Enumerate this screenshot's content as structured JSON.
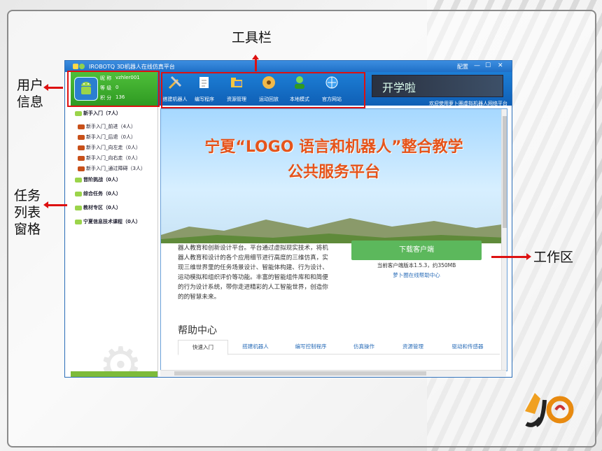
{
  "annotations": {
    "toolbar": "工具栏",
    "user_info": [
      "用户",
      "信息"
    ],
    "task_list": [
      "任务",
      "列表",
      "窗格"
    ],
    "work_area": "工作区"
  },
  "window": {
    "title": "IROBOTQ 3D机器人在线仿真平台",
    "config_label": "配置",
    "min_glyph": "—",
    "max_glyph": "☐",
    "close_glyph": "✕"
  },
  "user": {
    "nickname_label": "昵 称",
    "nickname": "vzhler001",
    "level_label": "等 级",
    "level": "0",
    "points_label": "积 分",
    "points": "136"
  },
  "toolbar": {
    "buttons": [
      {
        "label": "搭建机器人",
        "icon": "wrench-icon"
      },
      {
        "label": "编写程序",
        "icon": "notepad-icon"
      },
      {
        "label": "资源管理",
        "icon": "folder-icon"
      },
      {
        "label": "运动回放",
        "icon": "film-icon"
      },
      {
        "label": "本地模式",
        "icon": "user-icon"
      },
      {
        "label": "官方网站",
        "icon": "globe-icon"
      }
    ],
    "banner_text": "开学啦",
    "welcome": "欢迎使用萝卜圈虚拟机器人网络平台"
  },
  "sidebar": {
    "cat1": "新手入门（7人）",
    "sub1": "新手入门_前进（4人）",
    "sub2": "新手入门_后退（0人）",
    "sub3": "新手入门_向左走（0人）",
    "sub4": "新手入门_向右走（0人）",
    "sub5": "新手入门_通过障碍（3人）",
    "cat2": "晋阶挑战（0人）",
    "cat3": "综合任务（0人）",
    "cat4": "教材专区（0人）",
    "cat5": "宁夏信息技术课程（0人）"
  },
  "work": {
    "hero_line1": "宁夏“LOGO 语言和机器人”整合教学",
    "hero_line2": "公共服务平台",
    "intro": "器人教育和创新设计平台。平台通过虚拟现实技术，将机器人教育和设计的各个应用细节进行高度的三维仿真，实现三维世界里的任务场景设计、智能体构建、行为设计、运动模拟和组织评价等功能。丰富的智能组件库和和简便的行为设计系统，带你走进精彩的人工智能世界，创造你的的智慧未来。",
    "download": "下载客户端",
    "version": "当前客户端版本1.5.3，约350MB",
    "help_link": "萝卜圈在线帮助中心",
    "help_title": "帮助中心",
    "help_tabs": [
      "快速入门",
      "搭建机器人",
      "编写控制程序",
      "仿真操作",
      "资源管理",
      "驱动和传感器"
    ]
  },
  "colors": {
    "annotation_arrow": "#dd1111",
    "highlight_box": "#dd1111",
    "hero_title": "#e5541b",
    "download_button": "#5cb85c"
  }
}
